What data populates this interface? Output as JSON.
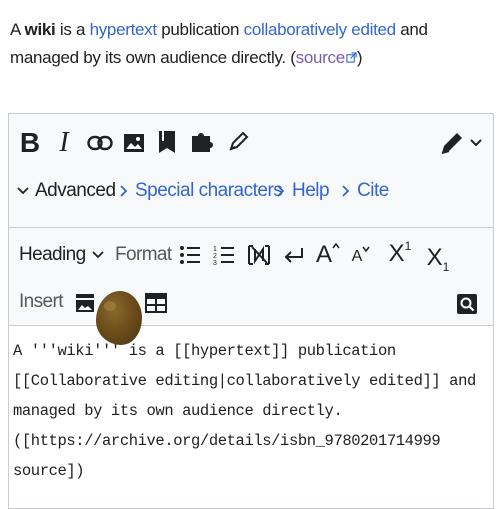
{
  "intro": {
    "article": "A ",
    "wiki": "wiki",
    "is_a": " is a ",
    "hypertext": "hypertext",
    "publication": " publication ",
    "collab": "collaboratively edited",
    "managed": " and managed by its own audience directly. (",
    "source": "source",
    "close": ")"
  },
  "toolbar": {
    "bold": "B",
    "italic": "I",
    "link_icon": "link-icon",
    "image_icon": "image-icon",
    "cite_icon": "bookmark-icon",
    "puzzle_icon": "puzzle-icon",
    "signature_icon": "pencil-icon",
    "edit_mode_icon": "pencil-edit-icon"
  },
  "tabs": [
    {
      "label": "Advanced",
      "active": true
    },
    {
      "label": "Special characters"
    },
    {
      "label": "Help"
    },
    {
      "label": "Cite"
    }
  ],
  "advanced": {
    "heading": "Heading",
    "format": "Format",
    "insert": "Insert",
    "superscript_base": "X",
    "superscript_exp": "1",
    "subscript_base": "X",
    "subscript_sub": "1",
    "big_a": "A",
    "small_a": "A"
  },
  "textarea": {
    "line1": "A '''wiki''' is a [[hypertext]] publication",
    "line2": "[[Collaborative editing|collaboratively edited]] and",
    "line3": "managed by its own audience directly.",
    "line4": "([https://archive.org/details/isbn_9780201714999",
    "line5": "source])"
  },
  "colors": {
    "link": "#3366cc",
    "visited": "#795cb2",
    "toolbar_bg": "#f8f9fa",
    "border": "#c8ccd1"
  }
}
